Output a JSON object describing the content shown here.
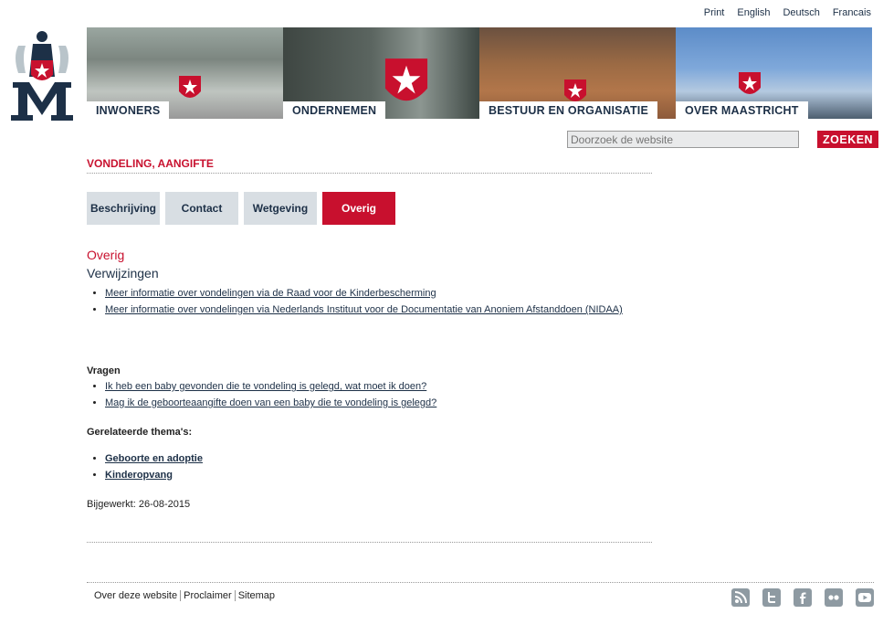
{
  "lang": [
    "Print",
    "English",
    "Deutsch",
    "Francais"
  ],
  "banner": [
    {
      "label": "INWONERS"
    },
    {
      "label": "ONDERNEMEN"
    },
    {
      "label": "BESTUUR EN ORGANISATIE"
    },
    {
      "label": "OVER MAASTRICHT"
    }
  ],
  "search": {
    "placeholder": "Doorzoek de website",
    "button": "ZOEKEN"
  },
  "page_title": "VONDELING, AANGIFTE",
  "tabs": [
    "Beschrijving",
    "Contact",
    "Wetgeving",
    "Overig"
  ],
  "content": {
    "section": "Overig",
    "heading": "Verwijzingen",
    "links": [
      "Meer informatie over vondelingen via de Raad voor de Kinderbescherming",
      "Meer informatie over vondelingen via Nederlands Instituut voor de Documentatie van Anoniem Afstanddoen (NIDAA)"
    ],
    "questions_label": "Vragen",
    "questions": [
      "Ik heb een baby gevonden die te vondeling is gelegd, wat moet ik doen?",
      "Mag ik de geboorteaangifte doen van een baby die te vondeling is gelegd?"
    ],
    "themes_label": "Gerelateerde thema's:",
    "themes": [
      "Geboorte en adoptie",
      "Kinderopvang"
    ],
    "updated": "Bijgewerkt: 26-08-2015"
  },
  "footer": {
    "links": [
      "Over deze website",
      "Proclaimer",
      "Sitemap"
    ]
  },
  "social": [
    "rss-icon",
    "twitter-icon",
    "facebook-icon",
    "flickr-icon",
    "youtube-icon"
  ],
  "colors": {
    "accent": "#c8102e",
    "navy": "#1d3047",
    "tab": "#d8dee3"
  }
}
